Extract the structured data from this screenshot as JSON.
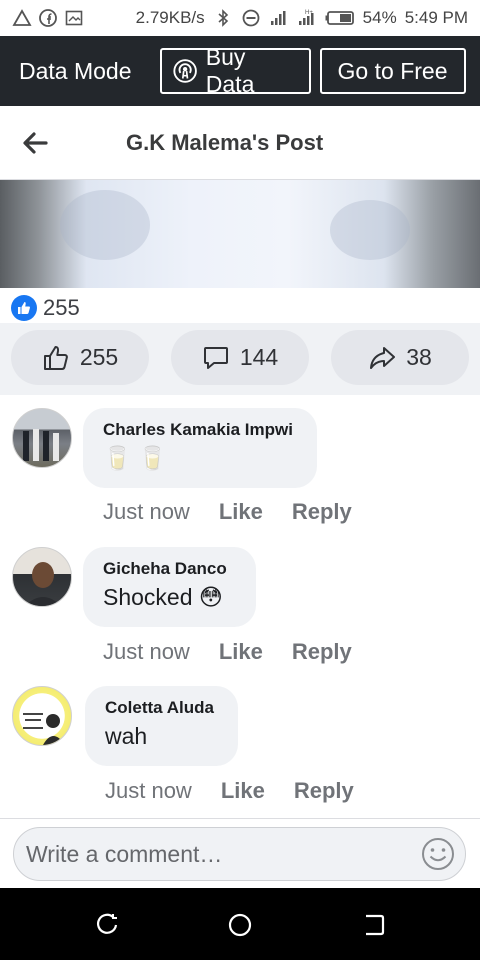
{
  "status_bar": {
    "speed": "2.79KB/s",
    "battery": "54%",
    "time": "5:49 PM",
    "icons": [
      "warning-icon",
      "facebook-icon",
      "image-icon",
      "bluetooth-icon",
      "dnd-icon",
      "signal-icon",
      "signal-h-icon",
      "battery-icon"
    ]
  },
  "data_bar": {
    "mode_label": "Data Mode",
    "buy_label": "Buy Data",
    "free_label": "Go to Free"
  },
  "header": {
    "title": "G.K Malema's Post"
  },
  "post": {
    "reaction_count": "255",
    "like_count": "255",
    "comment_count": "144",
    "share_count": "38"
  },
  "comments": [
    {
      "name": "Charles Kamakia Impwi",
      "text": "🥛 🥛",
      "time": "Just now",
      "like": "Like",
      "reply": "Reply"
    },
    {
      "name": "Gicheha Danco",
      "text": "Shocked 😳",
      "time": "Just now",
      "like": "Like",
      "reply": "Reply"
    },
    {
      "name": "Coletta Aluda",
      "text": "wah",
      "time": "Just now",
      "like": "Like",
      "reply": "Reply"
    }
  ],
  "composer": {
    "placeholder": "Write a comment…"
  },
  "colors": {
    "accent": "#1877f2",
    "databar": "#23272c",
    "pill": "#e4e6eb",
    "bubble": "#f0f2f5"
  }
}
